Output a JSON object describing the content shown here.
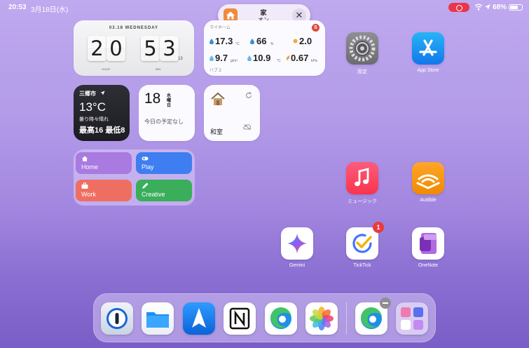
{
  "status_bar": {
    "time": "20:53",
    "date": "3月18日(水)",
    "battery": "68%"
  },
  "focus": {
    "title": "家",
    "state": "オン"
  },
  "clock_widget": {
    "date": "03.18 WEDNESDAY",
    "h1": "2",
    "h2": "0",
    "m1": "5",
    "m2": "3",
    "seconds": "13",
    "hour_label": "HOUR",
    "min_label": "MIN"
  },
  "switchbot_widget": {
    "title": "マイホーム",
    "badge": "S",
    "temp": "17.3",
    "temp_unit": "°C",
    "humidity": "66",
    "humidity_unit": "%",
    "co2": "2.0",
    "abs_humidity": "9.7",
    "abs_unit": "g/m³",
    "dew": "10.9",
    "dew_unit": "°C",
    "vpd": "0.67",
    "vpd_unit": "kPa",
    "footer": "ハブ２"
  },
  "weather_widget": {
    "city": "三郷市",
    "temp": "13°C",
    "condition": "曇り時々晴れ",
    "high": "最高16",
    "low": "最低8"
  },
  "calendar_widget": {
    "day": "18",
    "dow_1": "水",
    "dow_2": "曜",
    "dow_3": "日",
    "events": "今日の予定なし"
  },
  "home_widget": {
    "room": "和室"
  },
  "shortcuts": {
    "home": "Home",
    "play": "Play",
    "work": "Work",
    "creative": "Creative"
  },
  "apps": {
    "settings": "設定",
    "appstore": "App Store",
    "music": "ミュージック",
    "audible": "Audible",
    "gemini": "Gemini",
    "ticktick": "TickTick",
    "ticktick_badge": "1",
    "onenote": "OneNote"
  },
  "colors": {
    "accent_red": "#e8374a",
    "background_top": "#bfa9ef",
    "background_bottom": "#7a5ec7"
  }
}
